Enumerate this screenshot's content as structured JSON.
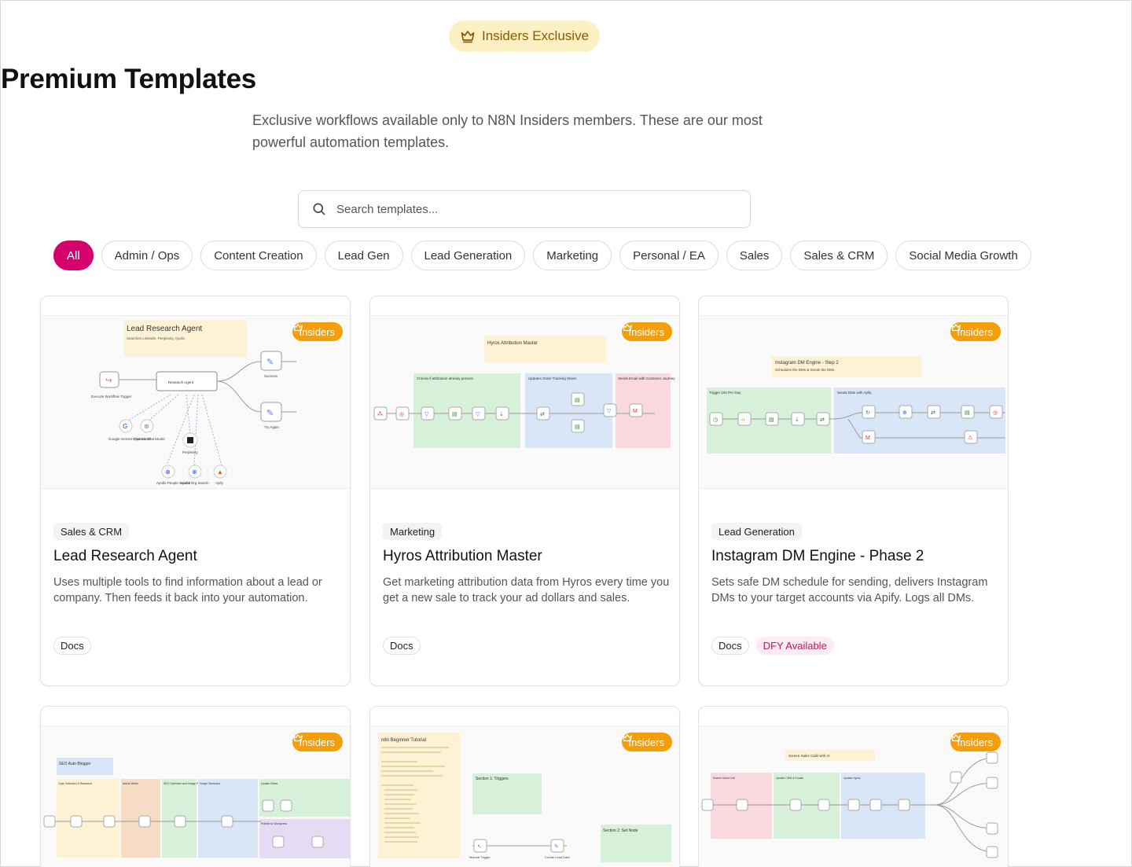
{
  "hero": {
    "badge_label": "Insiders Exclusive",
    "badge_icon": "crown-icon",
    "title": "Premium Templates",
    "subtitle": "Exclusive workflows available only to N8N Insiders members. These are our most powerful automation templates."
  },
  "search": {
    "placeholder": "Search templates...",
    "value": "",
    "icon": "search-icon"
  },
  "filters": [
    {
      "label": "All",
      "active": true
    },
    {
      "label": "Admin / Ops"
    },
    {
      "label": "Content Creation"
    },
    {
      "label": "Lead Gen"
    },
    {
      "label": "Lead Generation"
    },
    {
      "label": "Marketing"
    },
    {
      "label": "Personal / EA"
    },
    {
      "label": "Sales"
    },
    {
      "label": "Sales & CRM"
    },
    {
      "label": "Social Media Growth"
    }
  ],
  "colors": {
    "accent": "#d6006d",
    "insiders_badge": "#f59e0b",
    "hero_badge_bg": "#fdf0c2",
    "dfy_bg": "#fdeaf4"
  },
  "cards": [
    {
      "badge": "Insiders",
      "category": "Sales & CRM",
      "title": "Lead Research Agent",
      "description": "Uses multiple tools to find information about a lead or company. Then feeds it back into your automation.",
      "tags": [
        "Docs"
      ],
      "preview": {
        "note_title": "Lead Research Agent",
        "note_subtitle": "Searches LinkedIn, Perplexity, Apollo",
        "nodes": [
          "Execute Workflow Trigger",
          "Research Agent",
          "Success",
          "Try Again",
          "Google Gemini Chat Model",
          "OpenAI Chat Model",
          "Perplexity",
          "Apollo People Search",
          "Apollo Org Search",
          "Apify"
        ]
      }
    },
    {
      "badge": "Insiders",
      "category": "Marketing",
      "title": "Hyros Attribution Master",
      "description": "Get marketing attribution data from Hyros every time you get a new sale to track your ad dollars and sales.",
      "tags": [
        "Docs"
      ],
      "preview": {
        "note_title": "Hyros Attribution Master",
        "sections": [
          "Checks if attribution already present",
          "Updates Order Tracking Sheet",
          "Sends Email with Customer Journey"
        ]
      }
    },
    {
      "badge": "Insiders",
      "category": "Lead Generation",
      "title": "Instagram DM Engine - Phase 2",
      "description": "Sets safe DM schedule for sending, delivers Instagram DMs to your target accounts via Apify. Logs all DMs.",
      "tags": [
        "Docs",
        "DFY Available"
      ],
      "preview": {
        "note_title": "Instagram DM Engine - Step 2",
        "note_subtitle": "Schedules the DMs & Sends the DMs",
        "sections": [
          "Trigger 100 Per Day",
          "Sends DMs with Apify"
        ]
      }
    },
    {
      "badge": "Insiders",
      "preview": {
        "note_title": "SEO Auto Blogger",
        "sections": [
          "Topic Selection & Research",
          "Article Writer",
          "SEO Optimizer and Image Prompt Generator",
          "Image Generator",
          "Update Sheet",
          "Publish to Wordpress"
        ]
      }
    },
    {
      "badge": "Insiders",
      "preview": {
        "note_title": "n8n Beginner Tutorial",
        "sections": [
          "Section 1: Triggers",
          "Section 2: Set Node"
        ],
        "nodes": [
          "Manual Trigger",
          "Create Lead Data"
        ]
      }
    },
    {
      "badge": "Insiders",
      "preview": {
        "note_title": "Screen Sales Calls with AI",
        "sections": [
          "Screen Sales Call",
          "Update CRM & Emails",
          "Update Hyros"
        ]
      }
    }
  ]
}
